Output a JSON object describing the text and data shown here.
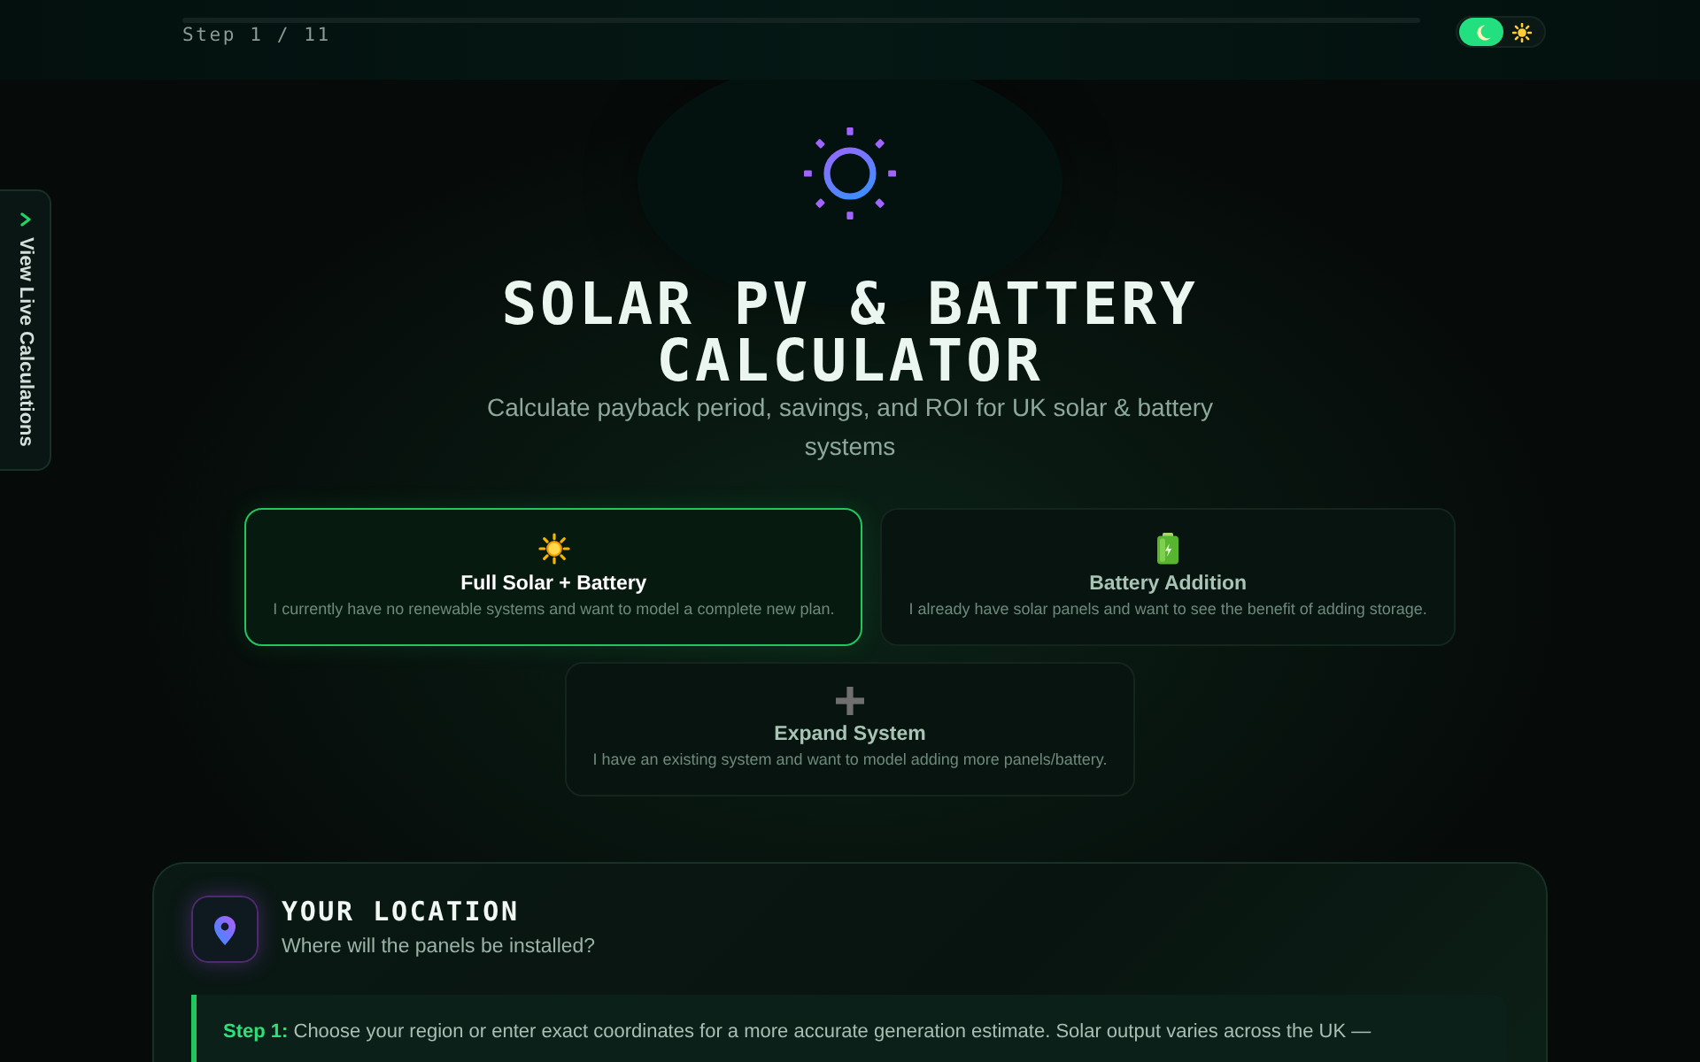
{
  "header": {
    "progress": {
      "level": 0
    },
    "step_label": "Step 1 / 11",
    "theme_toggle": {
      "dark_mode": true
    }
  },
  "side_tab": {
    "label": "View Live Calculations"
  },
  "hero": {
    "title": "SOLAR PV & BATTERY CALCULATOR",
    "subtitle": "Calculate payback period, savings, and ROI for UK solar & battery systems"
  },
  "system_options": [
    {
      "kind": "sun",
      "title": "Full Solar + Battery",
      "description": "I currently have no renewable systems and want to model a complete new plan.",
      "selected": true
    },
    {
      "kind": "battery",
      "title": "Battery Addition",
      "description": "I already have solar panels and want to see the benefit of adding storage.",
      "selected": false
    },
    {
      "kind": "plus",
      "title": "Expand System",
      "description": "I have an existing system and want to model adding more panels/battery.",
      "selected": false
    }
  ],
  "location_section": {
    "title": "YOUR LOCATION",
    "subtitle": "Where will the panels be installed?",
    "info": "**Step 1:** Choose your region or enter exact coordinates for a more accurate generation estimate. Solar output varies across the UK —"
  }
}
